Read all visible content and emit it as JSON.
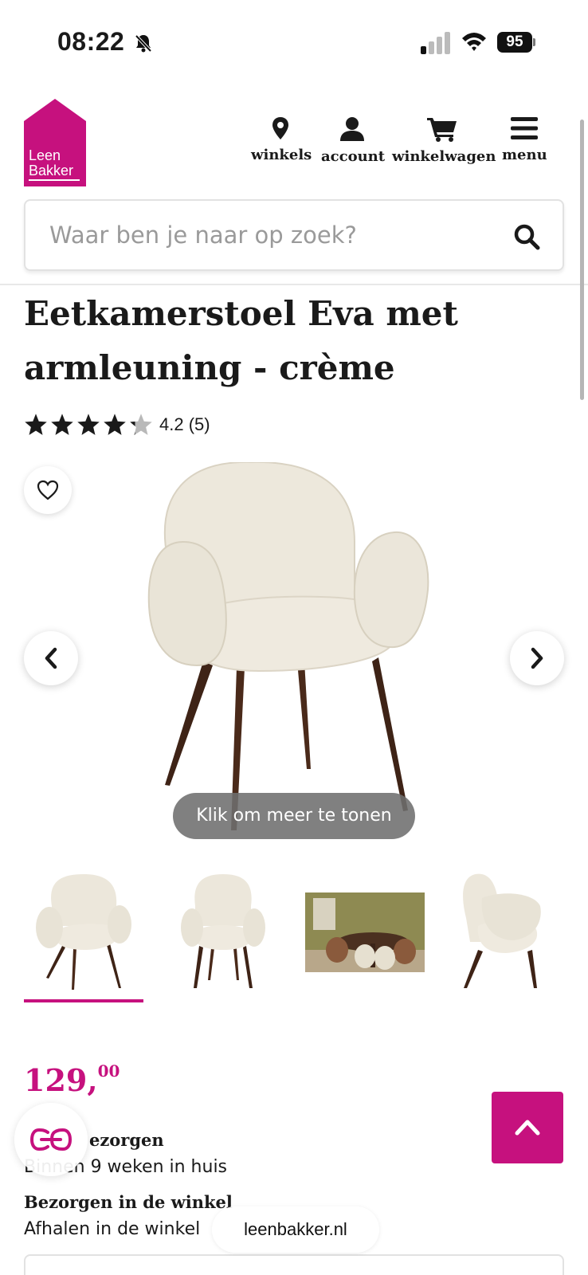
{
  "status_bar": {
    "time": "08:22",
    "battery": "95"
  },
  "brand": {
    "logo_line1": "Leen",
    "logo_line2": "Bakker",
    "color": "#c6117e"
  },
  "nav": {
    "items": [
      {
        "label": "winkels",
        "icon": "map-pin-icon"
      },
      {
        "label": "account",
        "icon": "user-icon"
      },
      {
        "label": "winkelwagen",
        "icon": "cart-icon"
      },
      {
        "label": "menu",
        "icon": "hamburger-menu-icon"
      }
    ]
  },
  "search": {
    "placeholder": "Waar ben je naar op zoek?",
    "value": ""
  },
  "product": {
    "title": "Eetkamerstoel Eva met armleuning - crème",
    "rating": 4.2,
    "rating_text": "4.2 (5)",
    "gallery_hint": "Klik om meer te tonen",
    "price_main": "129,",
    "price_cents": "00",
    "delivery_title_partial": "ezorgen",
    "delivery_sub": "Binnen 9 weken in huis",
    "store_title": "Bezorgen in de winkel",
    "store_sub": "Afhalen in de winkel"
  },
  "browser": {
    "url": "leenbakker.nl"
  },
  "colors": {
    "accent": "#c6117e",
    "text": "#1a1a1a",
    "star_full": "#1a1a1a",
    "star_empty": "#b9b9b9"
  }
}
